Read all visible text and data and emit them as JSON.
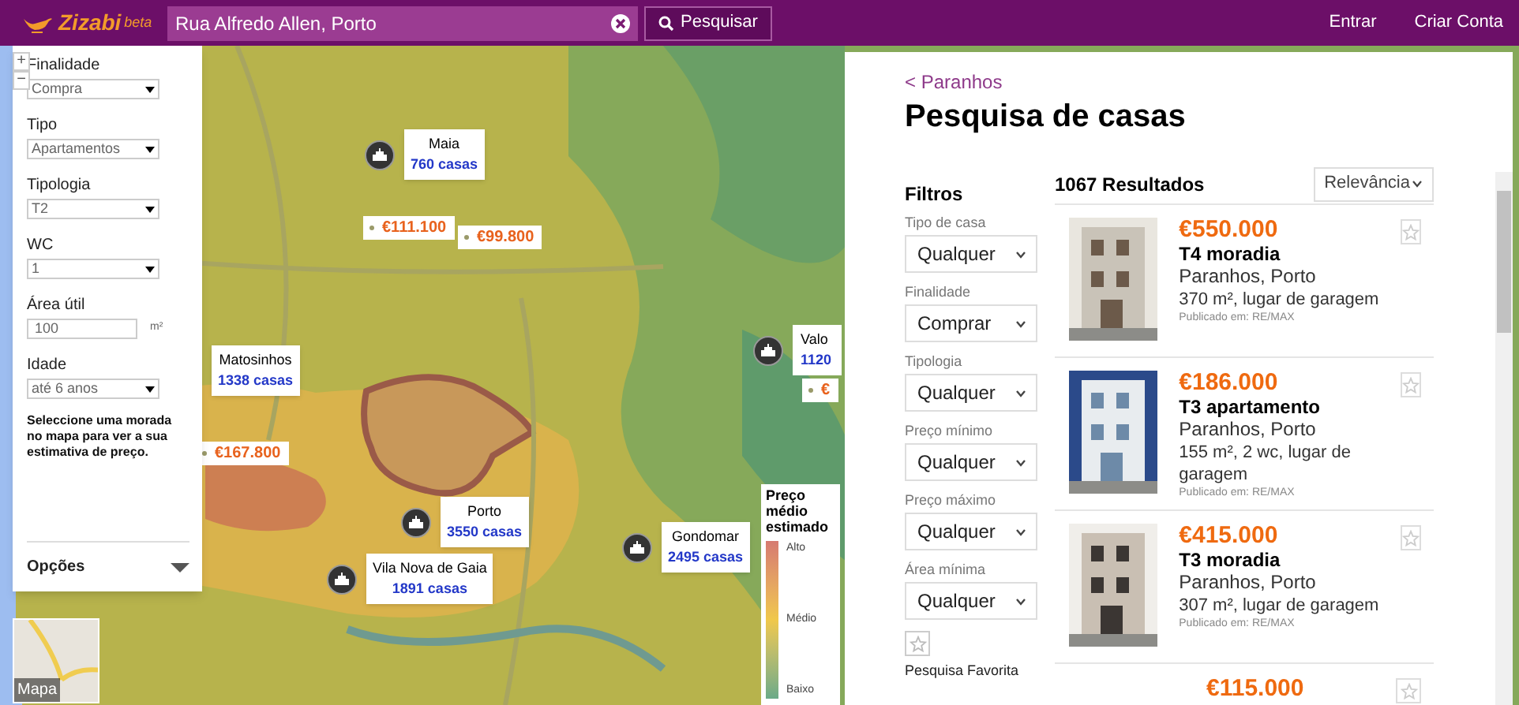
{
  "header": {
    "logo": "Zizabi",
    "logo_badge": "beta",
    "search": {
      "value": "Rua Alfredo Allen, Porto"
    },
    "search_button": "Pesquisar",
    "links": [
      "Entrar",
      "Criar Conta"
    ]
  },
  "map": {
    "zoom_controls": [
      "+",
      "−"
    ],
    "clusters": [
      {
        "name": "Maia",
        "count": "760 casas"
      },
      {
        "name": "Matosinhos",
        "count": "1338 casas"
      },
      {
        "name": "Porto",
        "count": "3550 casas"
      },
      {
        "name": "Vila Nova de Gaia",
        "count": "1891 casas"
      },
      {
        "name": "Gondomar",
        "count": "2495 casas"
      },
      {
        "name": "Valo",
        "count": "1120"
      }
    ],
    "price_tags": [
      "€111.100",
      "€99.800",
      "€167.800",
      "€"
    ],
    "legend": {
      "title": "Preço médio estimado",
      "labels": [
        "Alto",
        "Médio",
        "Baixo"
      ]
    },
    "layer_toggle": "Mapa"
  },
  "estimator": {
    "fields": [
      {
        "label": "Finalidade",
        "kind": "select",
        "value": "Compra"
      },
      {
        "label": "Tipo",
        "kind": "select",
        "value": "Apartamentos"
      },
      {
        "label": "Tipologia",
        "kind": "select",
        "value": "T2"
      },
      {
        "label": "WC",
        "kind": "select",
        "value": "1"
      },
      {
        "label": "Área útil",
        "kind": "input",
        "value": "100",
        "unit": "m²"
      },
      {
        "label": "Idade",
        "kind": "select",
        "value": "até 6 anos"
      }
    ],
    "hint": "Seleccione uma morada no mapa para ver a sua estimativa de preço.",
    "options": "Opções"
  },
  "results_panel": {
    "back_link": "< Paranhos",
    "title": "Pesquisa de casas",
    "filters_title": "Filtros",
    "filters": [
      {
        "label": "Tipo de casa",
        "value": "Qualquer"
      },
      {
        "label": "Finalidade",
        "value": "Comprar"
      },
      {
        "label": "Tipologia",
        "value": "Qualquer"
      },
      {
        "label": "Preço mínimo",
        "value": "Qualquer"
      },
      {
        "label": "Preço máximo",
        "value": "Qualquer"
      },
      {
        "label": "Área mínima",
        "value": "Qualquer"
      }
    ],
    "favorite_search": "Pesquisa Favorita",
    "results_count": "1067 Resultados",
    "sort": "Relevância",
    "listings": [
      {
        "price": "€550.000",
        "title": "T4 moradia",
        "location": "Paranhos, Porto",
        "details": "370 m², lugar de garagem",
        "source": "Publicado em: RE/MAX"
      },
      {
        "price": "€186.000",
        "title": "T3 apartamento",
        "location": "Paranhos, Porto",
        "details": "155 m², 2 wc, lugar de garagem",
        "source": "Publicado em: RE/MAX"
      },
      {
        "price": "€415.000",
        "title": "T3 moradia",
        "location": "Paranhos, Porto",
        "details": "307 m², lugar de garagem",
        "source": "Publicado em: RE/MAX"
      },
      {
        "price": "€115.000"
      }
    ]
  }
}
